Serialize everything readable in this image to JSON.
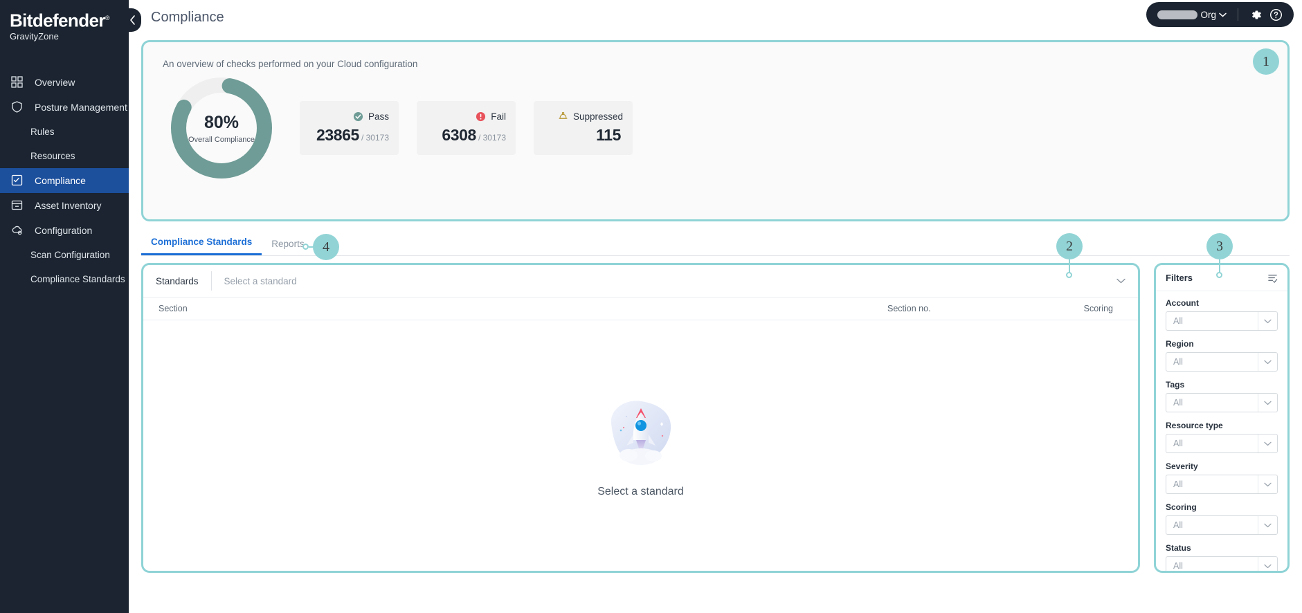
{
  "brand": {
    "name": "Bitdefender",
    "trademark": "®",
    "product": "GravityZone",
    "collapse_icon": "chevron-left-icon"
  },
  "header": {
    "title": "Compliance",
    "org": {
      "redacted": true,
      "label": "Org",
      "caret_icon": "chevron-down-icon"
    },
    "settings_icon": "gear-icon",
    "help_icon": "question-circle-icon"
  },
  "sidebar": {
    "items": [
      {
        "label": "Overview",
        "icon": "grid-icon",
        "active": false,
        "sub": false
      },
      {
        "label": "Posture Management",
        "icon": "shield-icon",
        "active": false,
        "sub": false
      },
      {
        "label": "Rules",
        "icon": "",
        "active": false,
        "sub": true
      },
      {
        "label": "Resources",
        "icon": "",
        "active": false,
        "sub": true
      },
      {
        "label": "Compliance",
        "icon": "checklist-icon",
        "active": true,
        "sub": false
      },
      {
        "label": "Asset Inventory",
        "icon": "inventory-icon",
        "active": false,
        "sub": false
      },
      {
        "label": "Configuration",
        "icon": "cloud-gear-icon",
        "active": false,
        "sub": false
      },
      {
        "label": "Scan Configuration",
        "icon": "",
        "active": false,
        "sub": true
      },
      {
        "label": "Compliance Standards",
        "icon": "",
        "active": false,
        "sub": true
      }
    ]
  },
  "overview": {
    "subtitle": "An overview of checks performed on your Cloud configuration",
    "donut": {
      "percent_label": "80%",
      "percent_value": 80,
      "caption": "Overall Compliance",
      "arc_color": "#6f9c96",
      "track_color": "#efefef"
    },
    "cards": [
      {
        "name": "Pass",
        "value": "23865",
        "denominator": "/ 30173",
        "icon": "check-circle-icon",
        "color": "#6f9c96"
      },
      {
        "name": "Fail",
        "value": "6308",
        "denominator": "/ 30173",
        "icon": "exclamation-circle-icon",
        "color": "#e8525b"
      },
      {
        "name": "Suppressed",
        "value": "115",
        "denominator": "",
        "icon": "suppressed-bell-icon",
        "color": "#b4952f"
      }
    ]
  },
  "tabs": [
    {
      "label": "Compliance Standards",
      "active": true
    },
    {
      "label": "Reports",
      "active": false
    }
  ],
  "standards": {
    "label": "Standards",
    "placeholder": "Select a standard",
    "caret_icon": "chevron-down-icon",
    "columns": {
      "section": "Section",
      "section_no": "Section no.",
      "scoring": "Scoring"
    },
    "empty_state": {
      "illustration": "rocket-illustration",
      "text": "Select a standard"
    }
  },
  "filters": {
    "title": "Filters",
    "toolbar_icon": "filter-list-icon",
    "groups": [
      {
        "label": "Account",
        "value": "All"
      },
      {
        "label": "Region",
        "value": "All"
      },
      {
        "label": "Tags",
        "value": "All"
      },
      {
        "label": "Resource type",
        "value": "All"
      },
      {
        "label": "Severity",
        "value": "All"
      },
      {
        "label": "Scoring",
        "value": "All"
      },
      {
        "label": "Status",
        "value": "All"
      }
    ]
  },
  "annotations": [
    {
      "number": "1",
      "target": "overview-panel"
    },
    {
      "number": "2",
      "target": "standards-table-panel"
    },
    {
      "number": "3",
      "target": "filters-panel"
    },
    {
      "number": "4",
      "target": "tabs-row"
    }
  ],
  "colors": {
    "accent_teal": "#8fd3d6",
    "marker": "#92d4d6",
    "active_tab": "#1d6fd6",
    "sidebar_bg": "#1b2430",
    "sidebar_active": "#1c4f9c"
  }
}
